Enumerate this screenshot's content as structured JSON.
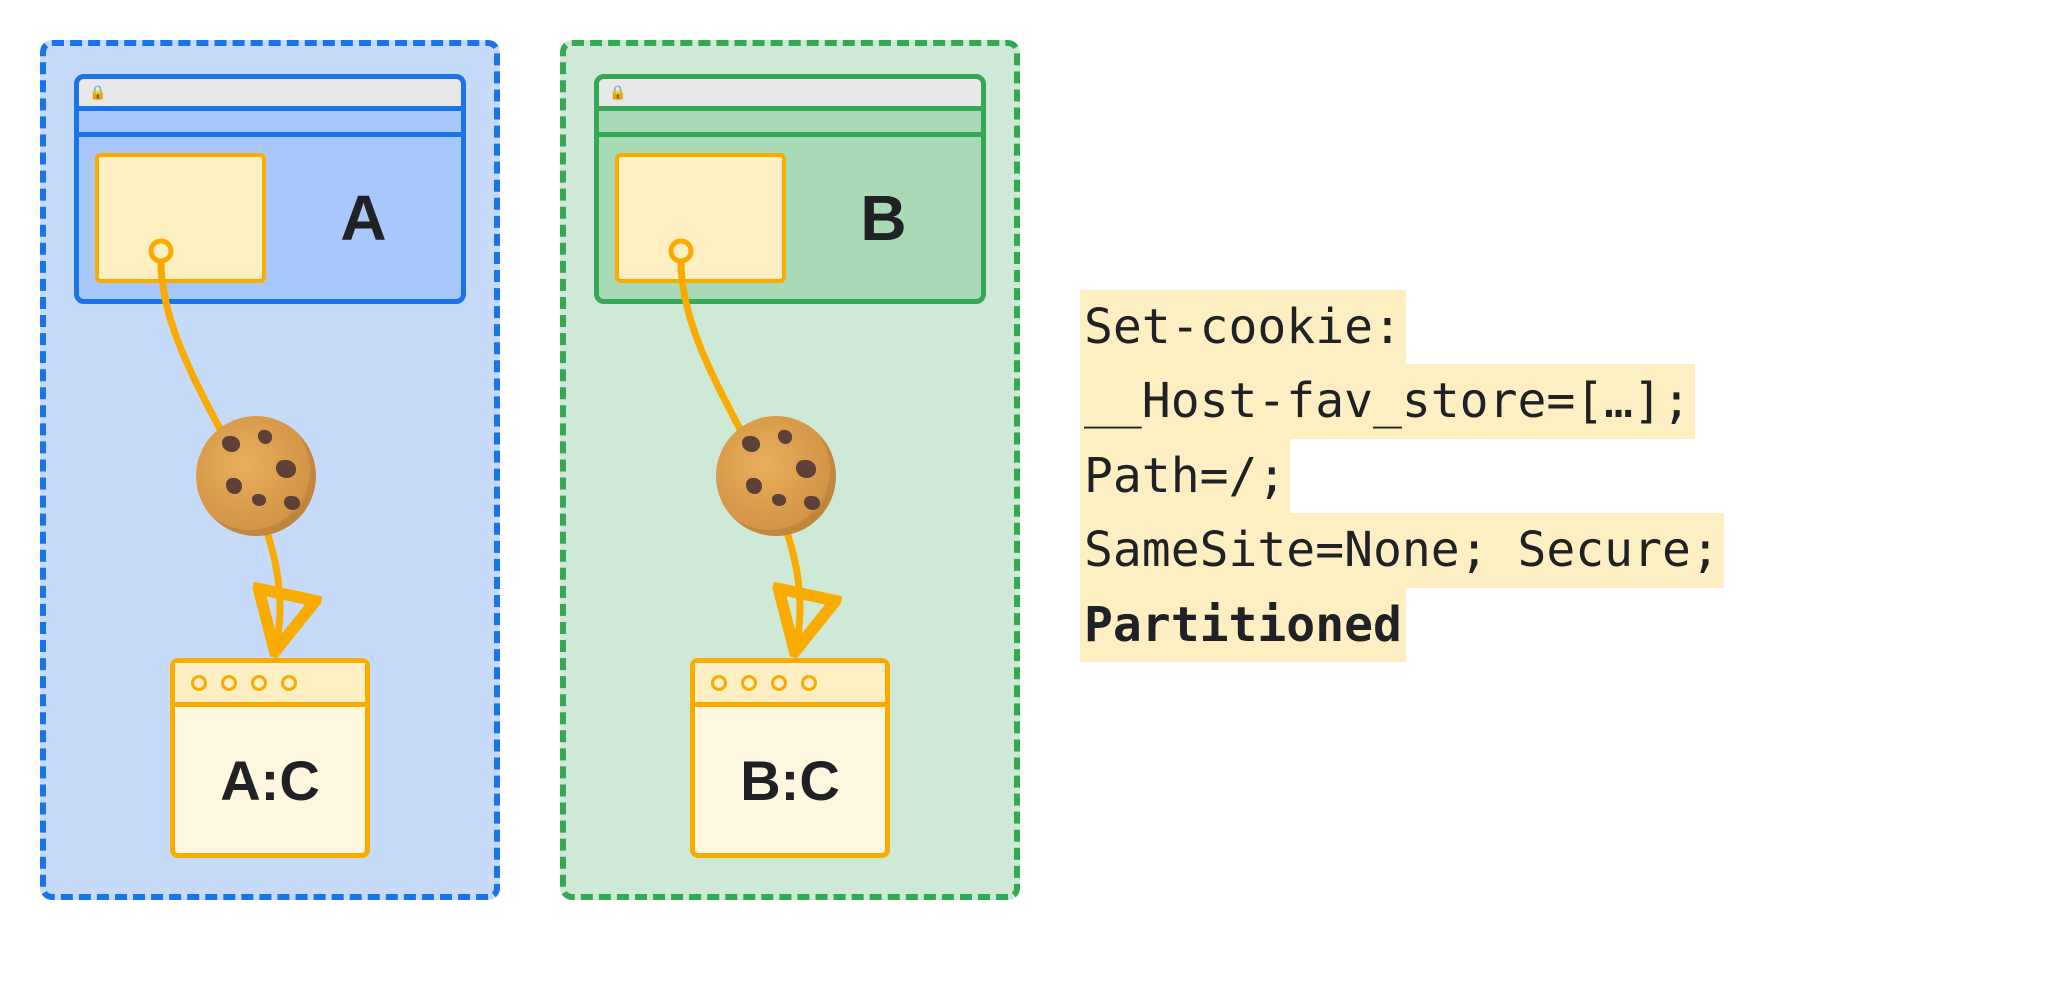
{
  "partitions": {
    "a": {
      "site_label": "A",
      "jar_label": "A:C"
    },
    "b": {
      "site_label": "B",
      "jar_label": "B:C"
    }
  },
  "code": {
    "l1": "Set-cookie:",
    "l2": "__Host-fav_store=[…];",
    "l3": "Path=/;",
    "l4": "SameSite=None; Secure;",
    "l5": "Partitioned"
  }
}
